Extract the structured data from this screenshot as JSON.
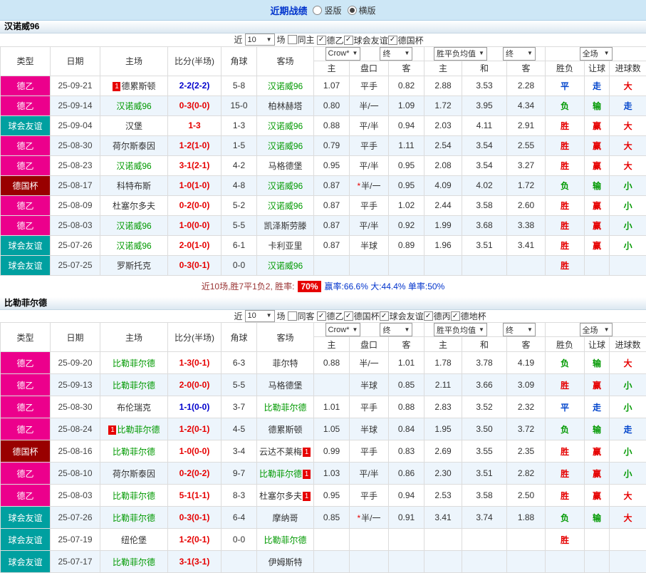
{
  "topbar": {
    "title": "近期战绩",
    "radios": [
      {
        "label": "竖版",
        "checked": false
      },
      {
        "label": "横版",
        "checked": true
      }
    ]
  },
  "columns": {
    "type": "类型",
    "date": "日期",
    "home": "主场",
    "score": "比分(半场)",
    "corner": "角球",
    "away": "客场",
    "odds_home": "主",
    "odds_handicap": "盘口",
    "odds_away": "客",
    "avg_home": "主",
    "avg_draw": "和",
    "avg_away": "客",
    "result_wl": "胜负",
    "result_handicap": "让球",
    "result_goals": "进球数"
  },
  "type_colors": {
    "德乙": "#ec008c",
    "球会友谊": "#00a0a0",
    "德国杯": "#990000",
    "德丙": "#888888",
    "德地杯": "#888888"
  },
  "result_colors": {
    "胜": "#e60000",
    "负": "#009900",
    "平": "#0044cc",
    "赢": "#e60000",
    "输": "#009900",
    "走": "#0044cc",
    "大": "#e60000",
    "小": "#009900"
  },
  "sections": [
    {
      "team": "汉诺威96",
      "filter": {
        "near": "近",
        "count": "10",
        "unit": "场",
        "same": "同主",
        "same_checked": false,
        "leagues": [
          {
            "label": "德乙",
            "checked": true
          },
          {
            "label": "球会友谊",
            "checked": true
          },
          {
            "label": "德国杯",
            "checked": true
          }
        ]
      },
      "dropdowns": {
        "bookmaker": "Crow*",
        "final1": "终",
        "average": "胜平负均值",
        "final2": "终",
        "scope": "全场"
      },
      "rows": [
        {
          "type": "德乙",
          "date": "25-09-21",
          "home": "德累斯顿",
          "home_focus": false,
          "home_badge": "pre",
          "score": "2-2(2-2)",
          "score_color": "blue",
          "corner": "5-8",
          "away": "汉诺威96",
          "away_focus": true,
          "odds": [
            "1.07",
            "平手",
            "0.82"
          ],
          "star": false,
          "avg": [
            "2.88",
            "3.53",
            "2.28"
          ],
          "results": [
            "平",
            "走",
            "大"
          ]
        },
        {
          "type": "德乙",
          "date": "25-09-14",
          "home": "汉诺威96",
          "home_focus": true,
          "score": "0-3(0-0)",
          "score_color": "red",
          "corner": "15-0",
          "away": "柏林赫塔",
          "away_focus": false,
          "odds": [
            "0.80",
            "半/一",
            "1.09"
          ],
          "star": false,
          "avg": [
            "1.72",
            "3.95",
            "4.34"
          ],
          "results": [
            "负",
            "输",
            "走"
          ]
        },
        {
          "type": "球会友谊",
          "date": "25-09-04",
          "home": "汉堡",
          "home_focus": false,
          "score": "1-3",
          "score_color": "red",
          "corner": "1-3",
          "away": "汉诺威96",
          "away_focus": true,
          "odds": [
            "0.88",
            "平/半",
            "0.94"
          ],
          "star": false,
          "avg": [
            "2.03",
            "4.11",
            "2.91"
          ],
          "results": [
            "胜",
            "赢",
            "大"
          ]
        },
        {
          "type": "德乙",
          "date": "25-08-30",
          "home": "荷尔斯泰因",
          "home_focus": false,
          "score": "1-2(1-0)",
          "score_color": "red",
          "corner": "1-5",
          "away": "汉诺威96",
          "away_focus": true,
          "odds": [
            "0.79",
            "平手",
            "1.11"
          ],
          "star": false,
          "avg": [
            "2.54",
            "3.54",
            "2.55"
          ],
          "results": [
            "胜",
            "赢",
            "大"
          ]
        },
        {
          "type": "德乙",
          "date": "25-08-23",
          "home": "汉诺威96",
          "home_focus": true,
          "score": "3-1(2-1)",
          "score_color": "red",
          "corner": "4-2",
          "away": "马格德堡",
          "away_focus": false,
          "odds": [
            "0.95",
            "平/半",
            "0.95"
          ],
          "star": false,
          "avg": [
            "2.08",
            "3.54",
            "3.27"
          ],
          "results": [
            "胜",
            "赢",
            "大"
          ]
        },
        {
          "type": "德国杯",
          "date": "25-08-17",
          "home": "科特布斯",
          "home_focus": false,
          "score": "1-0(1-0)",
          "score_color": "red",
          "corner": "4-8",
          "away": "汉诺威96",
          "away_focus": true,
          "odds": [
            "0.87",
            "半/一",
            "0.95"
          ],
          "star": true,
          "avg": [
            "4.09",
            "4.02",
            "1.72"
          ],
          "results": [
            "负",
            "输",
            "小"
          ]
        },
        {
          "type": "德乙",
          "date": "25-08-09",
          "home": "杜塞尔多夫",
          "home_focus": false,
          "score": "0-2(0-0)",
          "score_color": "red",
          "corner": "5-2",
          "away": "汉诺威96",
          "away_focus": true,
          "odds": [
            "0.87",
            "平手",
            "1.02"
          ],
          "star": false,
          "avg": [
            "2.44",
            "3.58",
            "2.60"
          ],
          "results": [
            "胜",
            "赢",
            "小"
          ]
        },
        {
          "type": "德乙",
          "date": "25-08-03",
          "home": "汉诺威96",
          "home_focus": true,
          "score": "1-0(0-0)",
          "score_color": "red",
          "corner": "5-5",
          "away": "凯泽斯劳滕",
          "away_focus": false,
          "odds": [
            "0.87",
            "平/半",
            "0.92"
          ],
          "star": false,
          "avg": [
            "1.99",
            "3.68",
            "3.38"
          ],
          "results": [
            "胜",
            "赢",
            "小"
          ]
        },
        {
          "type": "球会友谊",
          "date": "25-07-26",
          "home": "汉诺威96",
          "home_focus": true,
          "score": "2-0(1-0)",
          "score_color": "red",
          "corner": "6-1",
          "away": "卡利亚里",
          "away_focus": false,
          "odds": [
            "0.87",
            "半球",
            "0.89"
          ],
          "star": false,
          "avg": [
            "1.96",
            "3.51",
            "3.41"
          ],
          "results": [
            "胜",
            "赢",
            "小"
          ]
        },
        {
          "type": "球会友谊",
          "date": "25-07-25",
          "home": "罗斯托克",
          "home_focus": false,
          "score": "0-3(0-1)",
          "score_color": "red",
          "corner": "0-0",
          "away": "汉诺威96",
          "away_focus": true,
          "odds": [
            "",
            "",
            ""
          ],
          "star": false,
          "avg": [
            "",
            "",
            ""
          ],
          "results": [
            "胜",
            "",
            ""
          ]
        }
      ],
      "summary": {
        "lead": "近10场,胜7平1负2, 胜率:",
        "rate_badge": "70%",
        "stats": "赢率:66.6% 大:44.4% 单率:50%"
      }
    },
    {
      "team": "比勒菲尔德",
      "filter": {
        "near": "近",
        "count": "10",
        "unit": "场",
        "same": "同客",
        "same_checked": false,
        "leagues": [
          {
            "label": "德乙",
            "checked": true
          },
          {
            "label": "德国杯",
            "checked": true
          },
          {
            "label": "球会友谊",
            "checked": true
          },
          {
            "label": "德丙",
            "checked": true
          },
          {
            "label": "德地杯",
            "checked": true
          }
        ]
      },
      "dropdowns": {
        "bookmaker": "Crow*",
        "final1": "终",
        "average": "胜平负均值",
        "final2": "终",
        "scope": "全场"
      },
      "rows": [
        {
          "type": "德乙",
          "date": "25-09-20",
          "home": "比勒菲尔德",
          "home_focus": true,
          "score": "1-3(0-1)",
          "score_color": "red",
          "corner": "6-3",
          "away": "菲尔特",
          "away_focus": false,
          "odds": [
            "0.88",
            "半/一",
            "1.01"
          ],
          "star": false,
          "avg": [
            "1.78",
            "3.78",
            "4.19"
          ],
          "results": [
            "负",
            "输",
            "大"
          ]
        },
        {
          "type": "德乙",
          "date": "25-09-13",
          "home": "比勒菲尔德",
          "home_focus": true,
          "score": "2-0(0-0)",
          "score_color": "red",
          "corner": "5-5",
          "away": "马格德堡",
          "away_focus": false,
          "odds": [
            "",
            "半球",
            "0.85"
          ],
          "star": false,
          "avg": [
            "2.11",
            "3.66",
            "3.09"
          ],
          "results": [
            "胜",
            "赢",
            "小"
          ]
        },
        {
          "type": "德乙",
          "date": "25-08-30",
          "home": "布伦瑞克",
          "home_focus": false,
          "score": "1-1(0-0)",
          "score_color": "blue",
          "corner": "3-7",
          "away": "比勒菲尔德",
          "away_focus": true,
          "odds": [
            "1.01",
            "平手",
            "0.88"
          ],
          "star": false,
          "avg": [
            "2.83",
            "3.52",
            "2.32"
          ],
          "results": [
            "平",
            "走",
            "小"
          ]
        },
        {
          "type": "德乙",
          "date": "25-08-24",
          "home": "比勒菲尔德",
          "home_focus": true,
          "home_badge": "pre",
          "score": "1-2(0-1)",
          "score_color": "red",
          "corner": "4-5",
          "away": "德累斯顿",
          "away_focus": false,
          "odds": [
            "1.05",
            "半球",
            "0.84"
          ],
          "star": false,
          "avg": [
            "1.95",
            "3.50",
            "3.72"
          ],
          "results": [
            "负",
            "输",
            "走"
          ]
        },
        {
          "type": "德国杯",
          "date": "25-08-16",
          "home": "比勒菲尔德",
          "home_focus": true,
          "score": "1-0(0-0)",
          "score_color": "red",
          "corner": "3-4",
          "away": "云达不莱梅",
          "away_focus": false,
          "away_badge": "post",
          "odds": [
            "0.99",
            "平手",
            "0.83"
          ],
          "star": false,
          "avg": [
            "2.69",
            "3.55",
            "2.35"
          ],
          "results": [
            "胜",
            "赢",
            "小"
          ]
        },
        {
          "type": "德乙",
          "date": "25-08-10",
          "home": "荷尔斯泰因",
          "home_focus": false,
          "score": "0-2(0-2)",
          "score_color": "red",
          "corner": "9-7",
          "away": "比勒菲尔德",
          "away_focus": true,
          "away_badge": "post",
          "odds": [
            "1.03",
            "平/半",
            "0.86"
          ],
          "star": false,
          "avg": [
            "2.30",
            "3.51",
            "2.82"
          ],
          "results": [
            "胜",
            "赢",
            "小"
          ]
        },
        {
          "type": "德乙",
          "date": "25-08-03",
          "home": "比勒菲尔德",
          "home_focus": true,
          "score": "5-1(1-1)",
          "score_color": "red",
          "corner": "8-3",
          "away": "杜塞尔多夫",
          "away_focus": false,
          "away_badge": "post",
          "odds": [
            "0.95",
            "平手",
            "0.94"
          ],
          "star": false,
          "avg": [
            "2.53",
            "3.58",
            "2.50"
          ],
          "results": [
            "胜",
            "赢",
            "大"
          ]
        },
        {
          "type": "球会友谊",
          "date": "25-07-26",
          "home": "比勒菲尔德",
          "home_focus": true,
          "score": "0-3(0-1)",
          "score_color": "red",
          "corner": "6-4",
          "away": "摩纳哥",
          "away_focus": false,
          "odds": [
            "0.85",
            "半/一",
            "0.91"
          ],
          "star": true,
          "avg": [
            "3.41",
            "3.74",
            "1.88"
          ],
          "results": [
            "负",
            "输",
            "大"
          ]
        },
        {
          "type": "球会友谊",
          "date": "25-07-19",
          "home": "纽伦堡",
          "home_focus": false,
          "score": "1-2(0-1)",
          "score_color": "red",
          "corner": "0-0",
          "away": "比勒菲尔德",
          "away_focus": true,
          "odds": [
            "",
            "",
            ""
          ],
          "star": false,
          "avg": [
            "",
            "",
            ""
          ],
          "results": [
            "胜",
            "",
            ""
          ]
        },
        {
          "type": "球会友谊",
          "date": "25-07-17",
          "home": "比勒菲尔德",
          "home_focus": true,
          "score": "3-1(3-1)",
          "score_color": "red",
          "corner": "",
          "away": "伊姆斯特",
          "away_focus": false,
          "odds": [
            "",
            "",
            ""
          ],
          "star": false,
          "avg": [
            "",
            "",
            ""
          ],
          "results": [
            "",
            "",
            ""
          ]
        }
      ]
    }
  ]
}
